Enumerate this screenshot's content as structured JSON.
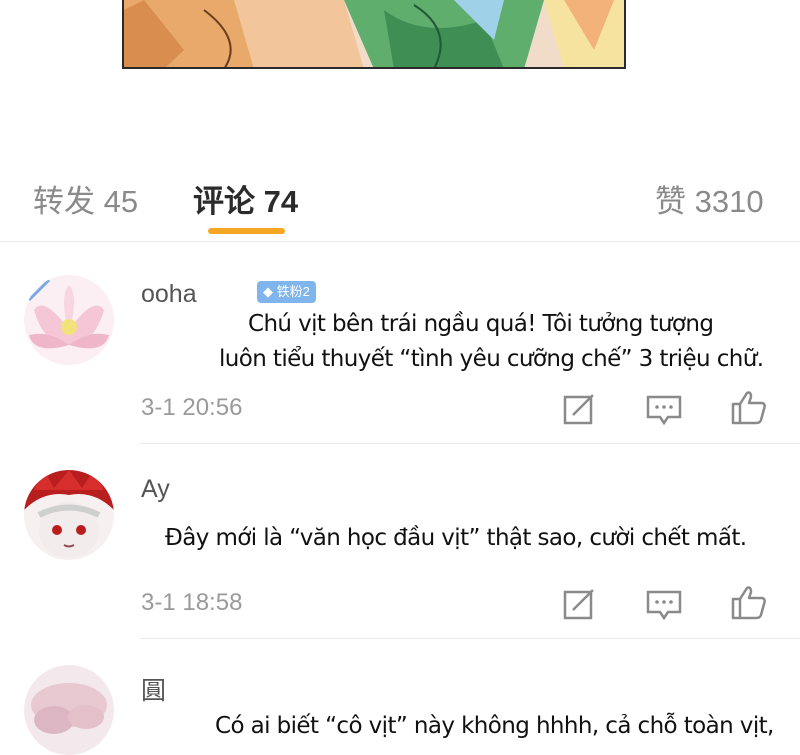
{
  "tabs": {
    "reposts": "转发 45",
    "comments": "评论 74",
    "likes": "赞 3310"
  },
  "comments": [
    {
      "username": "ooha",
      "badge": "铁粉2",
      "line1": "Chú vịt bên trái ngầu quá! Tôi tưởng tượng",
      "line2": "luôn tiểu thuyết “tình yêu cưỡng chế” 3 triệu chữ.",
      "time": "3-1 20:56"
    },
    {
      "username": "Ay",
      "line1": "Đây mới là “văn học đầu vịt” thật sao, cười chết mất.",
      "time": "3-1 18:58"
    },
    {
      "username": "圓",
      "line1": "Có ai biết “cô vịt” này không hhhh, cả chỗ toàn vịt,"
    }
  ],
  "colors": {
    "accent": "#f5a623",
    "badge": "#7fb5ec",
    "muted": "#9a9a9a"
  },
  "icons": [
    "repost-icon",
    "comment-icon",
    "like-icon"
  ]
}
